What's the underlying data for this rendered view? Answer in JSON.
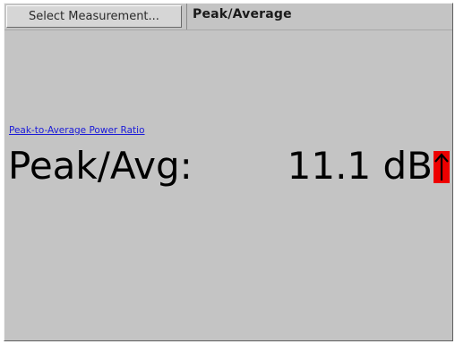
{
  "toolbar": {
    "select_label": "Select Measurement...",
    "mode_title": "Peak/Average"
  },
  "measurement": {
    "link_text": "Peak-to-Average Power Ratio",
    "label": "Peak/Avg:",
    "value": "11.1 dB",
    "indicator": "up-arrow-icon",
    "indicator_color": "#ee0000"
  },
  "colors": {
    "background": "#c4c4c4",
    "link": "#1b1bd8"
  }
}
